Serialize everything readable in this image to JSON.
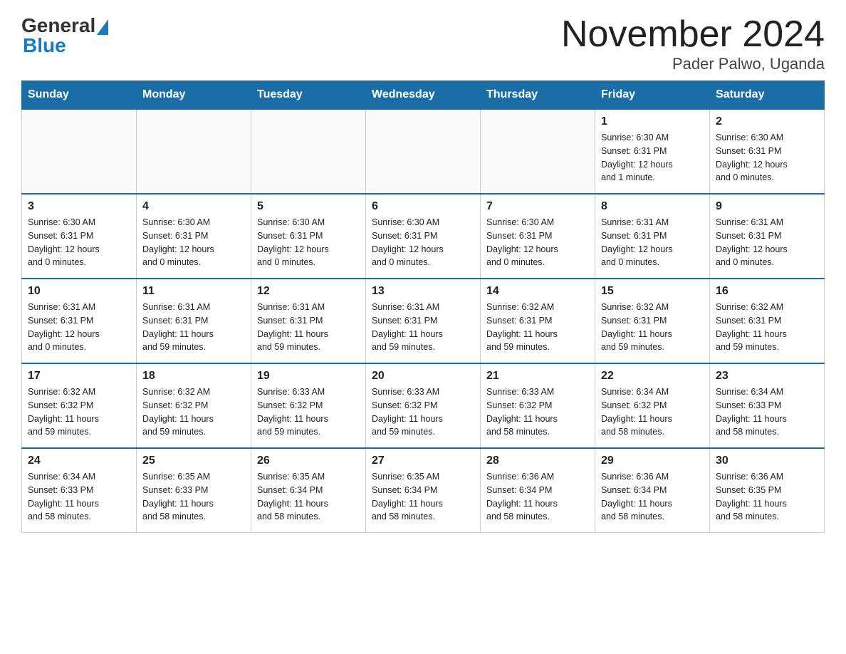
{
  "logo": {
    "general": "General",
    "triangle": "▲",
    "blue": "Blue"
  },
  "title": "November 2024",
  "location": "Pader Palwo, Uganda",
  "days_of_week": [
    "Sunday",
    "Monday",
    "Tuesday",
    "Wednesday",
    "Thursday",
    "Friday",
    "Saturday"
  ],
  "weeks": [
    [
      {
        "day": "",
        "info": ""
      },
      {
        "day": "",
        "info": ""
      },
      {
        "day": "",
        "info": ""
      },
      {
        "day": "",
        "info": ""
      },
      {
        "day": "",
        "info": ""
      },
      {
        "day": "1",
        "info": "Sunrise: 6:30 AM\nSunset: 6:31 PM\nDaylight: 12 hours\nand 1 minute."
      },
      {
        "day": "2",
        "info": "Sunrise: 6:30 AM\nSunset: 6:31 PM\nDaylight: 12 hours\nand 0 minutes."
      }
    ],
    [
      {
        "day": "3",
        "info": "Sunrise: 6:30 AM\nSunset: 6:31 PM\nDaylight: 12 hours\nand 0 minutes."
      },
      {
        "day": "4",
        "info": "Sunrise: 6:30 AM\nSunset: 6:31 PM\nDaylight: 12 hours\nand 0 minutes."
      },
      {
        "day": "5",
        "info": "Sunrise: 6:30 AM\nSunset: 6:31 PM\nDaylight: 12 hours\nand 0 minutes."
      },
      {
        "day": "6",
        "info": "Sunrise: 6:30 AM\nSunset: 6:31 PM\nDaylight: 12 hours\nand 0 minutes."
      },
      {
        "day": "7",
        "info": "Sunrise: 6:30 AM\nSunset: 6:31 PM\nDaylight: 12 hours\nand 0 minutes."
      },
      {
        "day": "8",
        "info": "Sunrise: 6:31 AM\nSunset: 6:31 PM\nDaylight: 12 hours\nand 0 minutes."
      },
      {
        "day": "9",
        "info": "Sunrise: 6:31 AM\nSunset: 6:31 PM\nDaylight: 12 hours\nand 0 minutes."
      }
    ],
    [
      {
        "day": "10",
        "info": "Sunrise: 6:31 AM\nSunset: 6:31 PM\nDaylight: 12 hours\nand 0 minutes."
      },
      {
        "day": "11",
        "info": "Sunrise: 6:31 AM\nSunset: 6:31 PM\nDaylight: 11 hours\nand 59 minutes."
      },
      {
        "day": "12",
        "info": "Sunrise: 6:31 AM\nSunset: 6:31 PM\nDaylight: 11 hours\nand 59 minutes."
      },
      {
        "day": "13",
        "info": "Sunrise: 6:31 AM\nSunset: 6:31 PM\nDaylight: 11 hours\nand 59 minutes."
      },
      {
        "day": "14",
        "info": "Sunrise: 6:32 AM\nSunset: 6:31 PM\nDaylight: 11 hours\nand 59 minutes."
      },
      {
        "day": "15",
        "info": "Sunrise: 6:32 AM\nSunset: 6:31 PM\nDaylight: 11 hours\nand 59 minutes."
      },
      {
        "day": "16",
        "info": "Sunrise: 6:32 AM\nSunset: 6:31 PM\nDaylight: 11 hours\nand 59 minutes."
      }
    ],
    [
      {
        "day": "17",
        "info": "Sunrise: 6:32 AM\nSunset: 6:32 PM\nDaylight: 11 hours\nand 59 minutes."
      },
      {
        "day": "18",
        "info": "Sunrise: 6:32 AM\nSunset: 6:32 PM\nDaylight: 11 hours\nand 59 minutes."
      },
      {
        "day": "19",
        "info": "Sunrise: 6:33 AM\nSunset: 6:32 PM\nDaylight: 11 hours\nand 59 minutes."
      },
      {
        "day": "20",
        "info": "Sunrise: 6:33 AM\nSunset: 6:32 PM\nDaylight: 11 hours\nand 59 minutes."
      },
      {
        "day": "21",
        "info": "Sunrise: 6:33 AM\nSunset: 6:32 PM\nDaylight: 11 hours\nand 58 minutes."
      },
      {
        "day": "22",
        "info": "Sunrise: 6:34 AM\nSunset: 6:32 PM\nDaylight: 11 hours\nand 58 minutes."
      },
      {
        "day": "23",
        "info": "Sunrise: 6:34 AM\nSunset: 6:33 PM\nDaylight: 11 hours\nand 58 minutes."
      }
    ],
    [
      {
        "day": "24",
        "info": "Sunrise: 6:34 AM\nSunset: 6:33 PM\nDaylight: 11 hours\nand 58 minutes."
      },
      {
        "day": "25",
        "info": "Sunrise: 6:35 AM\nSunset: 6:33 PM\nDaylight: 11 hours\nand 58 minutes."
      },
      {
        "day": "26",
        "info": "Sunrise: 6:35 AM\nSunset: 6:34 PM\nDaylight: 11 hours\nand 58 minutes."
      },
      {
        "day": "27",
        "info": "Sunrise: 6:35 AM\nSunset: 6:34 PM\nDaylight: 11 hours\nand 58 minutes."
      },
      {
        "day": "28",
        "info": "Sunrise: 6:36 AM\nSunset: 6:34 PM\nDaylight: 11 hours\nand 58 minutes."
      },
      {
        "day": "29",
        "info": "Sunrise: 6:36 AM\nSunset: 6:34 PM\nDaylight: 11 hours\nand 58 minutes."
      },
      {
        "day": "30",
        "info": "Sunrise: 6:36 AM\nSunset: 6:35 PM\nDaylight: 11 hours\nand 58 minutes."
      }
    ]
  ],
  "colors": {
    "header_bg": "#1a6ea8",
    "header_text": "#ffffff",
    "border": "#1a6ea8"
  }
}
